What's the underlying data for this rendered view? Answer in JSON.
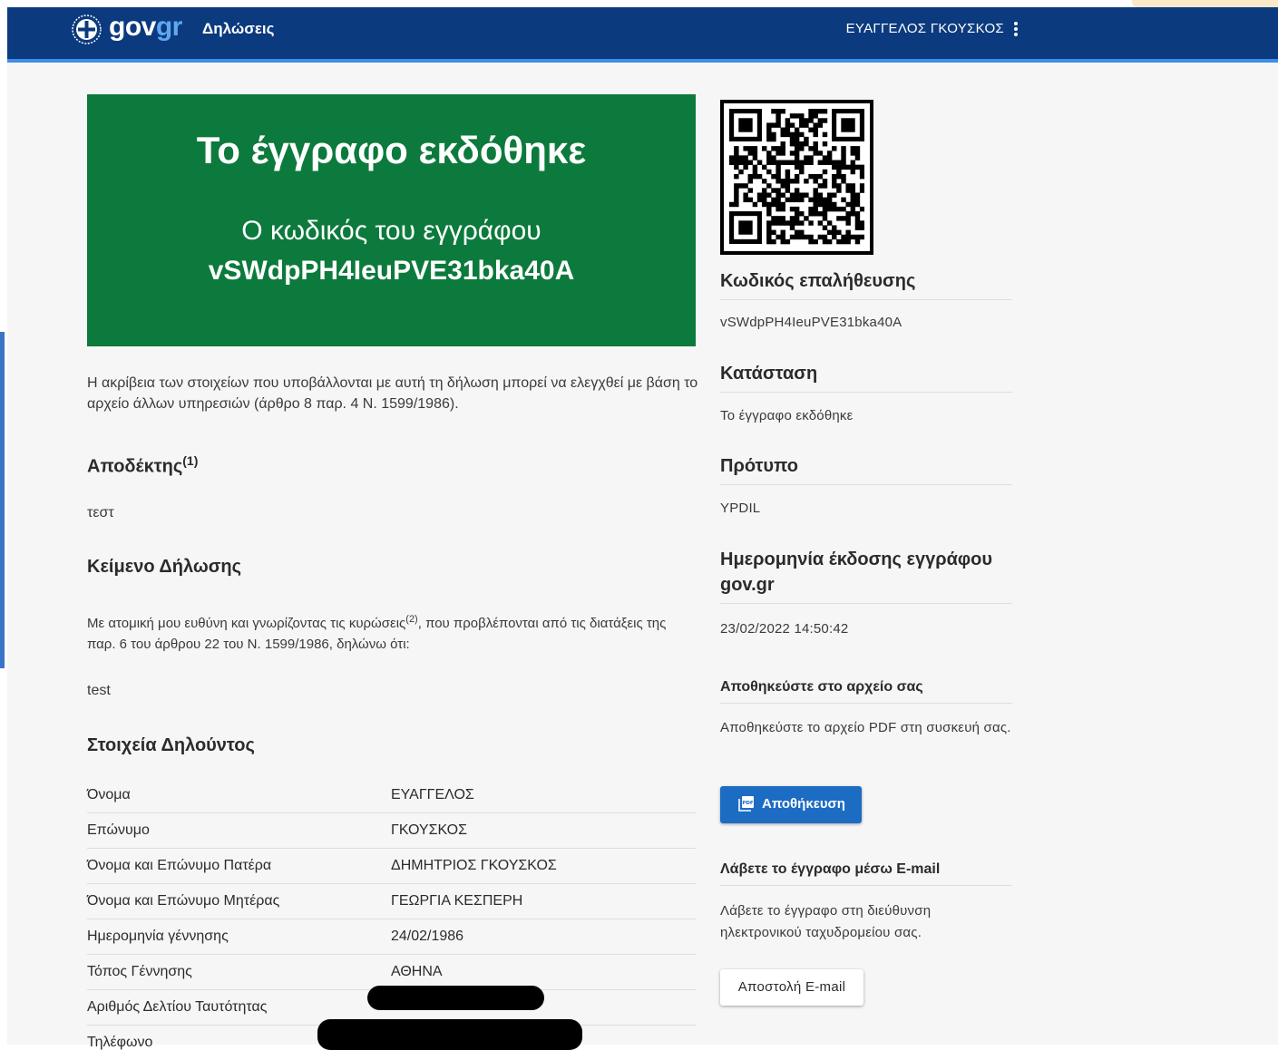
{
  "header": {
    "logo_main": "gov",
    "logo_accent": "gr",
    "nav_title": "Δηλώσεις",
    "user_name": "ΕΥΑΓΓΕΛΟΣ ΓΚΟΥΣΚΟΣ"
  },
  "banner": {
    "title": "Το έγγραφο εκδόθηκε",
    "subtitle": "Ο κωδικός του εγγράφου",
    "code": "vSWdpPH4IeuPVE31bka40A"
  },
  "intro": "Η ακρίβεια των στοιχείων που υποβάλλονται με αυτή τη δήλωση μπορεί να ελεγχθεί με βάση το αρχείο άλλων υπηρεσιών (άρθρο 8 παρ. 4 Ν. 1599/1986).",
  "recipient": {
    "heading": "Αποδέκτης",
    "footnote": "(1)",
    "value": "τεστ"
  },
  "declaration": {
    "heading": "Κείμενο Δήλωσης",
    "text_before": "Με ατομική μου ευθύνη και γνωρίζοντας τις κυρώσεις",
    "footnote": "(2)",
    "text_after": ", που προβλέπονται από τις διατάξεις της παρ. 6 του άρθρου 22 του Ν. 1599/1986, δηλώνω ότι:",
    "body": "test"
  },
  "declarant": {
    "heading": "Στοιχεία Δηλούντος",
    "rows": [
      {
        "label": "Όνομα",
        "value": "ΕΥΑΓΓΕΛΟΣ"
      },
      {
        "label": "Επώνυμο",
        "value": "ΓΚΟΥΣΚΟΣ"
      },
      {
        "label": "Όνομα και Επώνυμο Πατέρα",
        "value": "ΔΗΜΗΤΡΙΟΣ ΓΚΟΥΣΚΟΣ"
      },
      {
        "label": "Όνομα και Επώνυμο Μητέρας",
        "value": "ΓΕΩΡΓΙΑ ΚΕΣΠΕΡΗ"
      },
      {
        "label": "Ημερομηνία γέννησης",
        "value": "24/02/1986"
      },
      {
        "label": "Τόπος Γέννησης",
        "value": "ΑΘΗΝΑ"
      },
      {
        "label": "Αριθμός Δελτίου Ταυτότητας",
        "value": ""
      },
      {
        "label": "Τηλέφωνο",
        "value": ""
      }
    ]
  },
  "sidebar": {
    "verification_heading": "Κωδικός επαλήθευσης",
    "verification_code": "vSWdpPH4IeuPVE31bka40A",
    "status_heading": "Κατάσταση",
    "status_value": "Το έγγραφο εκδόθηκε",
    "template_heading": "Πρότυπο",
    "template_value": "YPDIL",
    "issue_date_heading": "Ημερομηνία έκδοσης εγγράφου gov.gr",
    "issue_date_value": "23/02/2022 14:50:42",
    "save_heading": "Αποθηκεύστε στο αρχείο σας",
    "save_text": "Αποθηκεύστε το αρχείο PDF στη συσκευή σας.",
    "save_button": "Αποθήκευση",
    "email_heading": "Λάβετε το έγγραφο μέσω E-mail",
    "email_text": "Λάβετε το έγγραφο στη διεύθυνση ηλεκτρονικού ταχυδρομείου σας.",
    "email_button": "Αποστολή E-mail"
  },
  "colors": {
    "header": "#0b3a7e",
    "header_accent": "#3d8ee6",
    "banner": "#0c7a3c",
    "primary_button": "#1d6cc4"
  },
  "icons": [
    "greek-emblem-icon",
    "more-vert-icon",
    "qr-code-icon",
    "pdf-icon"
  ]
}
